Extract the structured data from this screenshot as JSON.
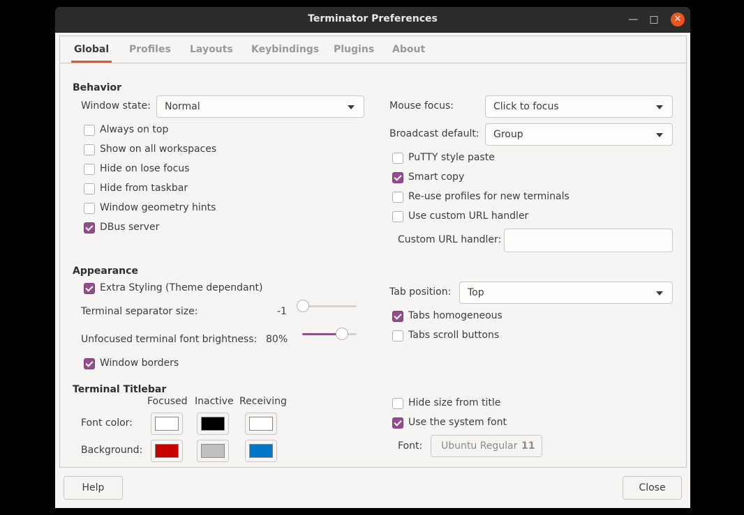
{
  "window": {
    "title": "Terminator Preferences"
  },
  "tabs": [
    "Global",
    "Profiles",
    "Layouts",
    "Keybindings",
    "Plugins",
    "About"
  ],
  "behavior": {
    "heading": "Behavior",
    "window_state_label": "Window state:",
    "window_state_value": "Normal",
    "checks": [
      {
        "label": "Always on top",
        "checked": false
      },
      {
        "label": "Show on all workspaces",
        "checked": false
      },
      {
        "label": "Hide on lose focus",
        "checked": false
      },
      {
        "label": "Hide from taskbar",
        "checked": false
      },
      {
        "label": "Window geometry hints",
        "checked": false
      },
      {
        "label": "DBus server",
        "checked": true
      }
    ],
    "mouse_focus_label": "Mouse focus:",
    "mouse_focus_value": "Click to focus",
    "broadcast_label": "Broadcast default:",
    "broadcast_value": "Group",
    "right_checks": [
      {
        "label": "PuTTY style paste",
        "checked": false
      },
      {
        "label": "Smart copy",
        "checked": true
      },
      {
        "label": "Re-use profiles for new terminals",
        "checked": false
      },
      {
        "label": "Use custom URL handler",
        "checked": false
      }
    ],
    "custom_url_label": "Custom URL handler:",
    "custom_url_value": ""
  },
  "appearance": {
    "heading": "Appearance",
    "extra_styling": {
      "label": "Extra Styling (Theme dependant)",
      "checked": true
    },
    "separator_label": "Terminal separator size:",
    "separator_value": "-1",
    "separator_fraction": 0.0,
    "brightness_label": "Unfocused terminal font brightness:",
    "brightness_value": "80%",
    "brightness_fraction": 0.8,
    "window_borders": {
      "label": "Window borders",
      "checked": true
    },
    "tab_position_label": "Tab position:",
    "tab_position_value": "Top",
    "right_checks": [
      {
        "label": "Tabs homogeneous",
        "checked": true
      },
      {
        "label": "Tabs scroll buttons",
        "checked": false
      }
    ]
  },
  "titlebar": {
    "heading": "Terminal Titlebar",
    "columns": [
      "Focused",
      "Inactive",
      "Receiving"
    ],
    "font_color_label": "Font color:",
    "background_label": "Background:",
    "font_colors": [
      "#ffffff",
      "#000000",
      "#ffffff"
    ],
    "background_colors": [
      "#c80000",
      "#c0c0c0",
      "#0076c9"
    ],
    "hide_size": {
      "label": "Hide size from title",
      "checked": false
    },
    "system_font": {
      "label": "Use the system font",
      "checked": true
    },
    "font_label": "Font:",
    "font_name": "Ubuntu Regular",
    "font_size": "11"
  },
  "footer": {
    "help_label": "Help",
    "close_label": "Close"
  }
}
